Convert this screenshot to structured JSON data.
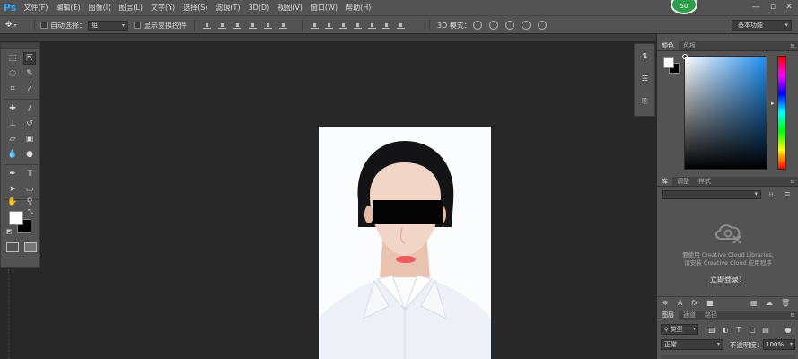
{
  "app": {
    "logo": "Ps",
    "user_badge": "50"
  },
  "menu": [
    "文件(F)",
    "编辑(E)",
    "图像(I)",
    "图层(L)",
    "文字(Y)",
    "选择(S)",
    "滤镜(T)",
    "3D(D)",
    "视图(V)",
    "窗口(W)",
    "帮助(H)"
  ],
  "window_controls": {
    "minimize": "—",
    "restore": "▫",
    "close": "✕"
  },
  "options": {
    "auto_select_label": "自动选择：",
    "auto_select_value": "组",
    "show_transform_label": "显示变换控件",
    "mode_3d_label": "3D 模式：",
    "workspace": "基本功能"
  },
  "tools": {
    "fg_color": "#ffffff",
    "bg_color": "#000000",
    "text_tool_glyph": "T"
  },
  "panels": {
    "color_tabs": [
      "颜色",
      "色板"
    ],
    "library_tabs": [
      "库",
      "调整",
      "样式"
    ],
    "library_message_line1": "要使用 Creative Cloud Libraries,",
    "library_message_line2": "请安装 Creative Cloud 应用程序",
    "login_link": "立即登录！",
    "layers_tabs": [
      "图层",
      "通道",
      "路径"
    ],
    "layer_kind": "类型",
    "blend_mode": "正常",
    "opacity_label": "不透明度：",
    "opacity_value": "100%",
    "panel_menu_icon": "≡"
  },
  "colors": {
    "accent_blue": "#31a8ff",
    "picker_hue": "#1e8ef0",
    "badge_green": "#2f9e4a"
  }
}
